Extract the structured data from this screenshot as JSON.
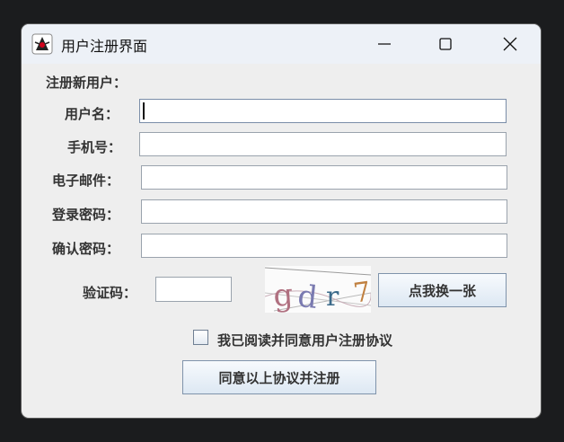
{
  "window": {
    "title": "用户注册界面",
    "icons": {
      "app": "java-duke-icon",
      "minimize": "minimize-icon",
      "maximize": "maximize-icon",
      "close": "close-icon"
    }
  },
  "form": {
    "section_title": "注册新用户：",
    "username": {
      "label": "用户名：",
      "value": ""
    },
    "phone": {
      "label": "手机号：",
      "value": ""
    },
    "email": {
      "label": "电子邮件：",
      "value": ""
    },
    "password": {
      "label": "登录密码：",
      "value": ""
    },
    "confirm_password": {
      "label": "确认密码：",
      "value": ""
    },
    "captcha": {
      "label": "验证码：",
      "value": "",
      "image_text": "gdr7"
    },
    "refresh_captcha_button": "点我换一张",
    "agreement": {
      "label": "我已阅读并同意用户注册协议",
      "checked": false
    },
    "submit_button": "同意以上协议并注册"
  },
  "colors": {
    "button_border": "#7f93ab",
    "window_bg": "#eeeeee",
    "titlebar_bg": "#edf1f7"
  }
}
